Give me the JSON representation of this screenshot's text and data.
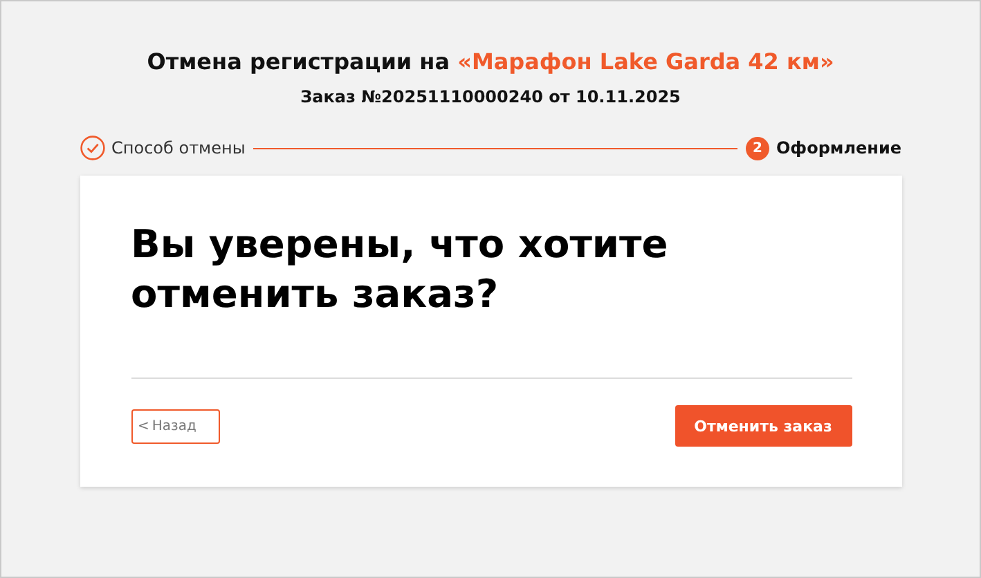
{
  "title": {
    "text": "Отмена регистрации на",
    "highlight": "«Марафон Lake Garda 42 км»"
  },
  "subtitle": "Заказ №20251110000240 от 10.11.2025",
  "steps": [
    {
      "label": "Способ отмены",
      "completed": true,
      "current": false
    },
    {
      "label": "Оформление",
      "completed": false,
      "current": true,
      "number": "2"
    }
  ],
  "card": {
    "heading": "Вы уверены, что хотите отменить заказ?",
    "back_button": {
      "icon": "<",
      "label": "Назад"
    },
    "confirm_button": "Отменить заказ"
  }
}
